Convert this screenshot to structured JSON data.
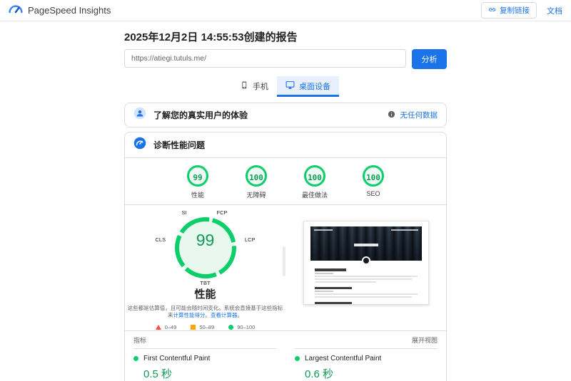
{
  "header": {
    "app_title": "PageSpeed Insights",
    "copy_link_label": "复制链接",
    "docs_label": "文档"
  },
  "report": {
    "title": "2025年12月2日 14:55:53创建的报告",
    "url_value": "https://atiegi.tutuls.me/",
    "analyze_label": "分析"
  },
  "tabs": {
    "mobile": "手机",
    "desktop": "桌面设备",
    "selected": "桌面设备"
  },
  "field_section": {
    "title": "了解您的真实用户的体验",
    "status_link": "无任何数据"
  },
  "diagnose_section": {
    "title": "诊断性能问题"
  },
  "category_scores": [
    {
      "value": "99",
      "label": "性能"
    },
    {
      "value": "100",
      "label": "无障碍"
    },
    {
      "value": "100",
      "label": "最佳做法"
    },
    {
      "value": "100",
      "label": "SEO"
    }
  ],
  "gauge": {
    "score": "99",
    "category": "性能",
    "labels": {
      "si": "SI",
      "fcp": "FCP",
      "cls": "CLS",
      "lcp": "LCP",
      "tbt": "TBT"
    },
    "desc_text": "这些都是估算值，且可能会随时间变化。系统会直接基于这些指标来",
    "desc_link_score": "计算性能得分",
    "desc_sep": "。",
    "desc_link_calc": "查看计算器",
    "desc_end": "。"
  },
  "score_legend": [
    {
      "range": "0–49"
    },
    {
      "range": "50–89"
    },
    {
      "range": "90–100"
    }
  ],
  "metrics": {
    "header": "指标",
    "expand_label": "展开视图",
    "items": [
      {
        "name": "First Contentful Paint",
        "value": "0.5 秒"
      },
      {
        "name": "Largest Contentful Paint",
        "value": "0.6 秒"
      }
    ]
  },
  "colors": {
    "accent_blue": "#1a73e8",
    "score_green": "#0cce6b",
    "score_green_text": "#0b9e56",
    "legend_red": "#ff4e42",
    "legend_orange": "#ffa400",
    "border_gray": "#dadce0",
    "tab_selected_bg": "#e8f0fe",
    "text_primary": "#202124",
    "text_secondary": "#5f6368"
  },
  "icons": {
    "logo": "speed-gauge-logo",
    "copy_link": "link-icon",
    "mobile_tab": "smartphone-icon",
    "desktop_tab": "desktop-icon",
    "field": "user-circle-icon",
    "diagnose": "gauge-circle-icon",
    "info": "info-icon",
    "metric_good": "green-dot"
  }
}
